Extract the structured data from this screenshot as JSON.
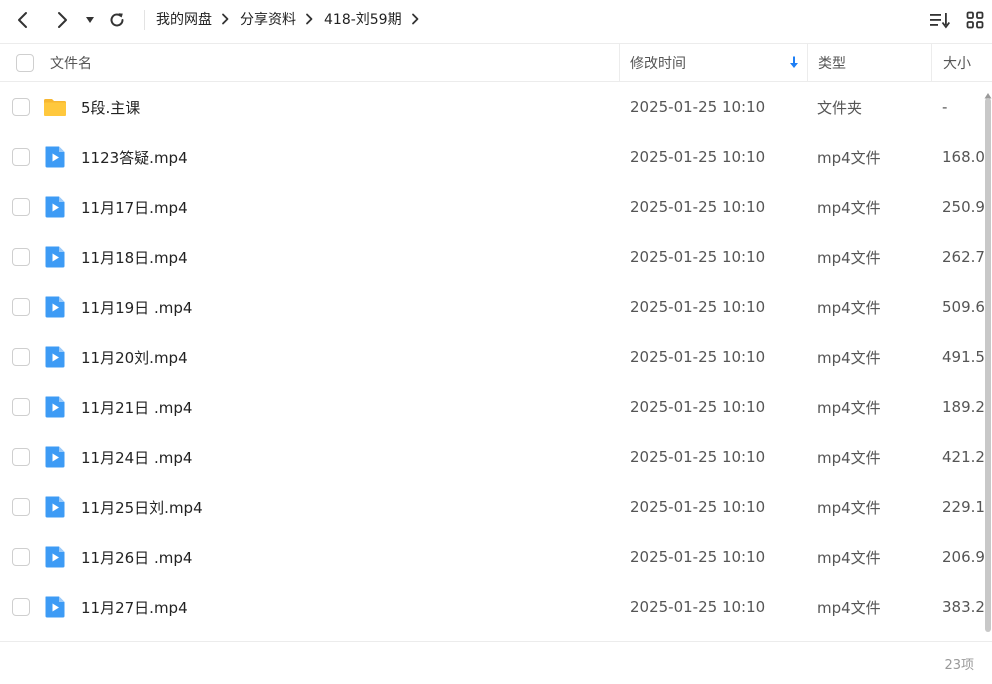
{
  "toolbar": {
    "back_icon": "chevron-left-icon",
    "forward_icon": "chevron-right-icon",
    "history_icon": "caret-down-icon",
    "refresh_icon": "refresh-icon",
    "sort_icon": "sort-list-icon",
    "grid_icon": "grid-view-icon"
  },
  "breadcrumb": [
    "我的网盘",
    "分享资料",
    "418-刘59期"
  ],
  "header": {
    "name": "文件名",
    "mtime": "修改时间",
    "type": "类型",
    "size": "大小",
    "sort_indicator": "arrow-down-icon"
  },
  "colors": {
    "folder": "#FFC83D",
    "video": "#3D9BF5",
    "sort_arrow": "#1E7FF5",
    "text_muted": "#999999"
  },
  "files": [
    {
      "name": "5段.主课",
      "mtime": "2025-01-25 10:10",
      "type": "文件夹",
      "size": "-",
      "icon": "folder-icon"
    },
    {
      "name": "1123答疑.mp4",
      "mtime": "2025-01-25 10:10",
      "type": "mp4文件",
      "size": "168.0",
      "icon": "video-icon"
    },
    {
      "name": "11月17日.mp4",
      "mtime": "2025-01-25 10:10",
      "type": "mp4文件",
      "size": "250.9",
      "icon": "video-icon"
    },
    {
      "name": "11月18日.mp4",
      "mtime": "2025-01-25 10:10",
      "type": "mp4文件",
      "size": "262.7",
      "icon": "video-icon"
    },
    {
      "name": "11月19日 .mp4",
      "mtime": "2025-01-25 10:10",
      "type": "mp4文件",
      "size": "509.6",
      "icon": "video-icon"
    },
    {
      "name": "11月20刘.mp4",
      "mtime": "2025-01-25 10:10",
      "type": "mp4文件",
      "size": "491.5",
      "icon": "video-icon"
    },
    {
      "name": "11月21日 .mp4",
      "mtime": "2025-01-25 10:10",
      "type": "mp4文件",
      "size": "189.2",
      "icon": "video-icon"
    },
    {
      "name": "11月24日 .mp4",
      "mtime": "2025-01-25 10:10",
      "type": "mp4文件",
      "size": "421.2",
      "icon": "video-icon"
    },
    {
      "name": "11月25日刘.mp4",
      "mtime": "2025-01-25 10:10",
      "type": "mp4文件",
      "size": "229.1",
      "icon": "video-icon"
    },
    {
      "name": "11月26日 .mp4",
      "mtime": "2025-01-25 10:10",
      "type": "mp4文件",
      "size": "206.9",
      "icon": "video-icon"
    },
    {
      "name": "11月27日.mp4",
      "mtime": "2025-01-25 10:10",
      "type": "mp4文件",
      "size": "383.2",
      "icon": "video-icon"
    }
  ],
  "footer": {
    "count": "23项"
  }
}
